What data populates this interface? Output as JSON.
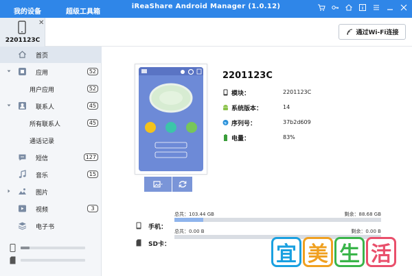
{
  "titlebar": {
    "tab_devices": "我的设备",
    "tab_toolbox": "超级工具箱",
    "title": "iReaShare Android Manager (1.0.12)",
    "bg_color": "#2f86e8"
  },
  "device_tab": {
    "name": "2201123C",
    "close": "✕"
  },
  "wifi_button": {
    "label": "通过Wi-Fi连接"
  },
  "sidebar": {
    "items": [
      {
        "label": "首页",
        "icon": "home-icon",
        "selected": true
      },
      {
        "label": "应用",
        "icon": "apps-icon",
        "badge": "52",
        "expanded": true
      },
      {
        "label": "用户应用",
        "badge": "52",
        "sub": true
      },
      {
        "label": "联系人",
        "icon": "contacts-icon",
        "badge": "45",
        "expanded": true
      },
      {
        "label": "所有联系人",
        "badge": "45",
        "sub": true
      },
      {
        "label": "通话记录",
        "sub": true
      },
      {
        "label": "短信",
        "icon": "sms-icon",
        "badge": "127"
      },
      {
        "label": "音乐",
        "icon": "music-icon",
        "badge": "15"
      },
      {
        "label": "图片",
        "icon": "photos-icon"
      },
      {
        "label": "视频",
        "icon": "video-icon",
        "badge": "3"
      },
      {
        "label": "电子书",
        "icon": "ebook-icon"
      }
    ],
    "storage_phone_fraction": 0.14,
    "storage_sd_fraction": 0
  },
  "device_info": {
    "title": "2201123C",
    "rows": [
      {
        "label": "模块：",
        "value": "2201123C",
        "icon": "phone-icon"
      },
      {
        "label": "系统版本：",
        "value": "14",
        "icon": "android-icon"
      },
      {
        "label": "序列号：",
        "value": "37b2d609",
        "icon": "globe-icon"
      },
      {
        "label": "电量：",
        "value": "83%",
        "icon": "battery-icon"
      }
    ]
  },
  "storage": [
    {
      "name": "手机：",
      "total": "总共：103.44 GB",
      "remaining": "剩余：88.68 GB",
      "used_fraction": 0.14
    },
    {
      "name": "SD卡：",
      "total": "总共：0.00 B",
      "remaining": "剩余：0.00 B",
      "used_fraction": 0
    }
  ],
  "watermark": {
    "chars": [
      "宜",
      "美",
      "生",
      "活"
    ],
    "colors": [
      "#1aa0e0",
      "#f0a020",
      "#3ab54a",
      "#e94f6b"
    ]
  }
}
